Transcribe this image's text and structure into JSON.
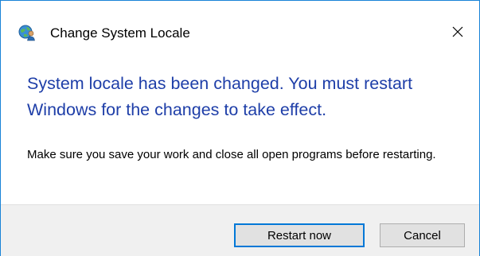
{
  "window": {
    "title": "Change System Locale",
    "app_icon": "globe-with-user-icon",
    "close_icon": "close-icon"
  },
  "message": {
    "main_instruction": "System locale has been changed. You must restart Windows for the changes to take effect.",
    "content": "Make sure you save your work and close all open programs before restarting."
  },
  "buttons": {
    "restart_label": "Restart now",
    "cancel_label": "Cancel"
  },
  "colors": {
    "accent_border": "#1883d7",
    "main_instruction": "#1e3ea8",
    "footer_bg": "#f0f0f0",
    "default_button_border": "#0078d7"
  }
}
